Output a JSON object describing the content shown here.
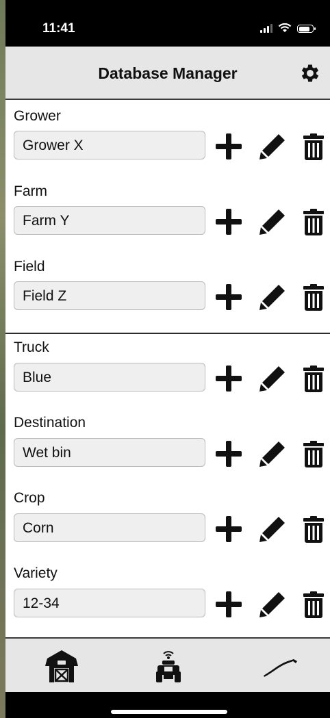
{
  "status": {
    "time": "11:41",
    "icons": [
      "signal-icon",
      "wifi-icon",
      "battery-icon"
    ]
  },
  "header": {
    "title": "Database Manager",
    "settings_icon": "gear-icon"
  },
  "groups": [
    {
      "rows": [
        {
          "label": "Grower",
          "value": "Grower X"
        },
        {
          "label": "Farm",
          "value": "Farm Y"
        },
        {
          "label": "Field",
          "value": "Field Z"
        }
      ]
    },
    {
      "rows": [
        {
          "label": "Truck",
          "value": "Blue"
        },
        {
          "label": "Destination",
          "value": "Wet bin"
        },
        {
          "label": "Crop",
          "value": "Corn"
        },
        {
          "label": "Variety",
          "value": "12-34"
        }
      ]
    }
  ],
  "row_actions": [
    "plus-icon",
    "pencil-icon",
    "trash-icon"
  ],
  "tabs": [
    {
      "icon": "barn-icon"
    },
    {
      "icon": "tractor-icon"
    },
    {
      "icon": "auger-icon"
    }
  ],
  "colors": {
    "bar_background": "#e6e6e6",
    "field_background": "#efefef",
    "icon_color": "#111111"
  }
}
